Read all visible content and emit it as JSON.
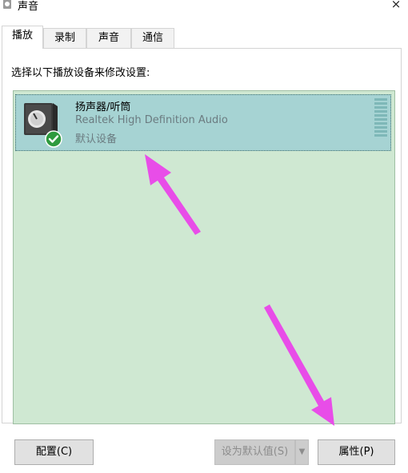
{
  "window": {
    "title": "声音",
    "close_glyph": "×"
  },
  "tabs": [
    {
      "label": "播放",
      "active": true
    },
    {
      "label": "录制",
      "active": false
    },
    {
      "label": "声音",
      "active": false
    },
    {
      "label": "通信",
      "active": false
    }
  ],
  "instruction": "选择以下播放设备来修改设置:",
  "devices": [
    {
      "name": "扬声器/听筒",
      "description": "Realtek High Definition Audio",
      "status": "默认设备",
      "icon": "speaker-icon",
      "badge_icon": "checkmark-icon",
      "selected": true
    }
  ],
  "buttons": {
    "configure": "配置(C)",
    "set_default": "设为默认值(S)",
    "properties": "属性(P)"
  },
  "colors": {
    "list_background": "#cfe8d2",
    "selected_item": "#a6d3d3",
    "annotation_arrow": "#e84de8",
    "check_badge": "#2e9a3e"
  }
}
